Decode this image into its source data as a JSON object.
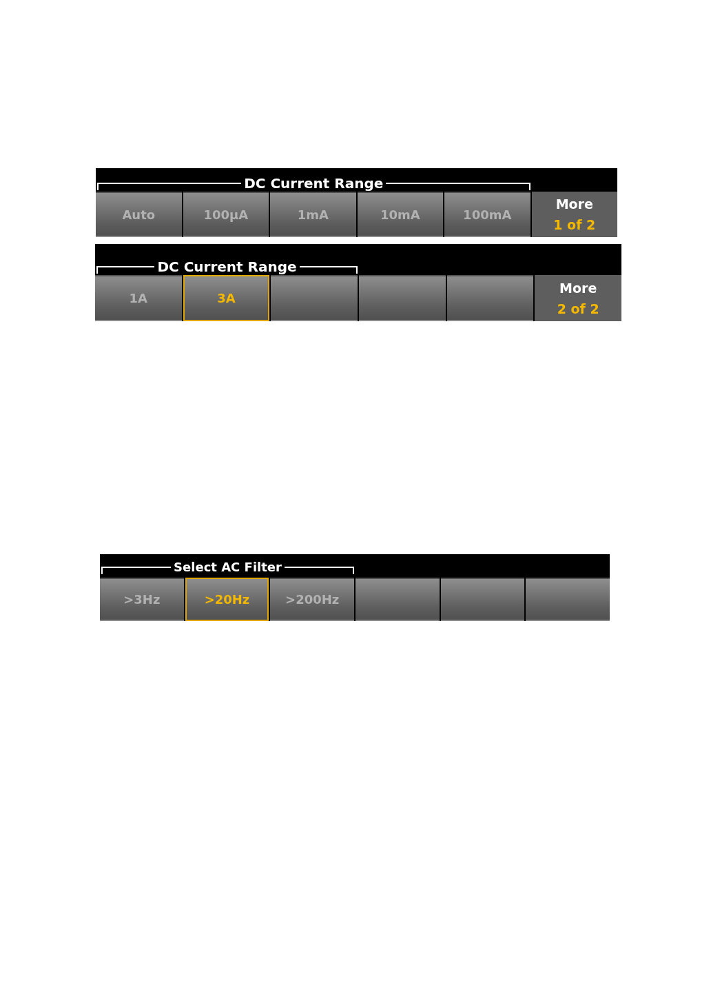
{
  "panels": [
    {
      "title": "DC Current Range",
      "group_keys": [
        {
          "label": "Auto",
          "selected": false
        },
        {
          "label": "100µA",
          "selected": false
        },
        {
          "label": "1mA",
          "selected": false
        },
        {
          "label": "10mA",
          "selected": false
        },
        {
          "label": "100mA",
          "selected": false
        }
      ],
      "more": {
        "label": "More",
        "page": "1 of 2"
      }
    },
    {
      "title": "DC Current Range",
      "group_keys": [
        {
          "label": "1A",
          "selected": false
        },
        {
          "label": "3A",
          "selected": true
        },
        {
          "selected": false
        }
      ],
      "other_keys": [
        {
          "selected": false
        },
        {
          "selected": false
        }
      ],
      "more": {
        "label": "More",
        "page": "2 of 2"
      }
    },
    {
      "title": "Select AC Filter",
      "group_keys": [
        {
          "label": ">3Hz",
          "selected": false
        },
        {
          "label": ">20Hz",
          "selected": true
        },
        {
          "label": ">200Hz",
          "selected": false
        }
      ],
      "other_keys": [
        {
          "selected": false
        },
        {
          "selected": false
        },
        {
          "selected": false
        }
      ]
    }
  ]
}
